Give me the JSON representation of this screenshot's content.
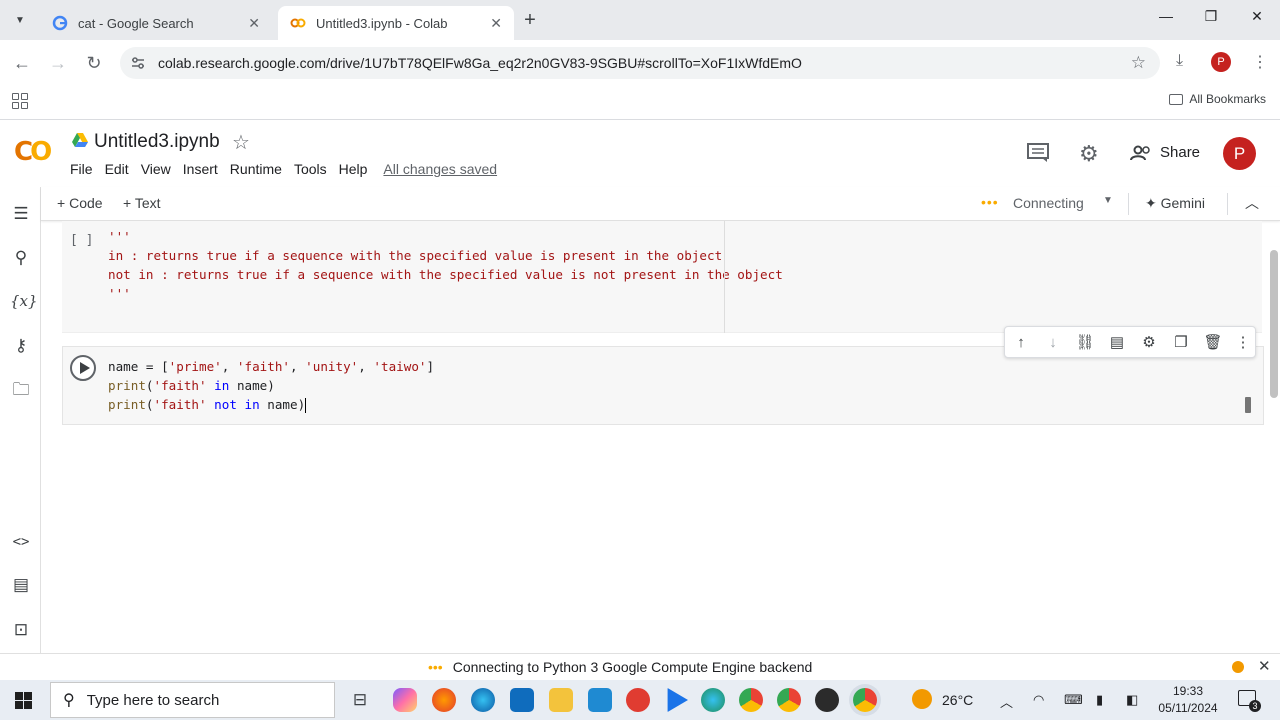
{
  "browser": {
    "tabs": [
      {
        "title": "cat - Google Search",
        "active": false
      },
      {
        "title": "Untitled3.ipynb - Colab",
        "active": true
      }
    ],
    "url": "colab.research.google.com/drive/1U7bT78QElFw8Ga_eq2r2n0GV83-9SGBU#scrollTo=XoF1IxWfdEmO",
    "profile_initial": "P",
    "bookmarks_label": "All Bookmarks"
  },
  "colab": {
    "notebook_title": "Untitled3.ipynb",
    "menu": [
      "File",
      "Edit",
      "View",
      "Insert",
      "Runtime",
      "Tools",
      "Help"
    ],
    "save_status": "All changes saved",
    "share_label": "Share",
    "avatar_initial": "P",
    "add_code": "Code",
    "add_text": "Text",
    "runtime_status": "Connecting",
    "gemini_label": "Gemini",
    "cell1": {
      "bracket": "[ ]",
      "lines": [
        "'''",
        "in : returns true if a sequence with the specified value is present in the object",
        "not in : returns true if a sequence with the specified value is not present in the object",
        "",
        "'''"
      ]
    },
    "cell2": {
      "line1": {
        "a": "name = [",
        "s1": "'prime'",
        "c1": ", ",
        "s2": "'faith'",
        "c2": ", ",
        "s3": "'unity'",
        "c3": ", ",
        "s4": "'taiwo'",
        "e": "]"
      },
      "line2": {
        "fn": "print",
        "p": "(",
        "s": "'faith'",
        "op": " in ",
        "rest": "name)"
      },
      "line3": {
        "fn": "print",
        "p": "(",
        "s": "'faith'",
        "op": " not in ",
        "rest": "name)"
      }
    },
    "status_bar": "Connecting to Python 3 Google Compute Engine backend"
  },
  "taskbar": {
    "search_placeholder": "Type here to search",
    "weather": "26°C",
    "time": "19:33",
    "date": "05/11/2024",
    "notifications": "3"
  },
  "colors": {
    "colab_orange": "#f9ab00",
    "profile_red": "#c5221f",
    "string_red": "#a31515"
  }
}
